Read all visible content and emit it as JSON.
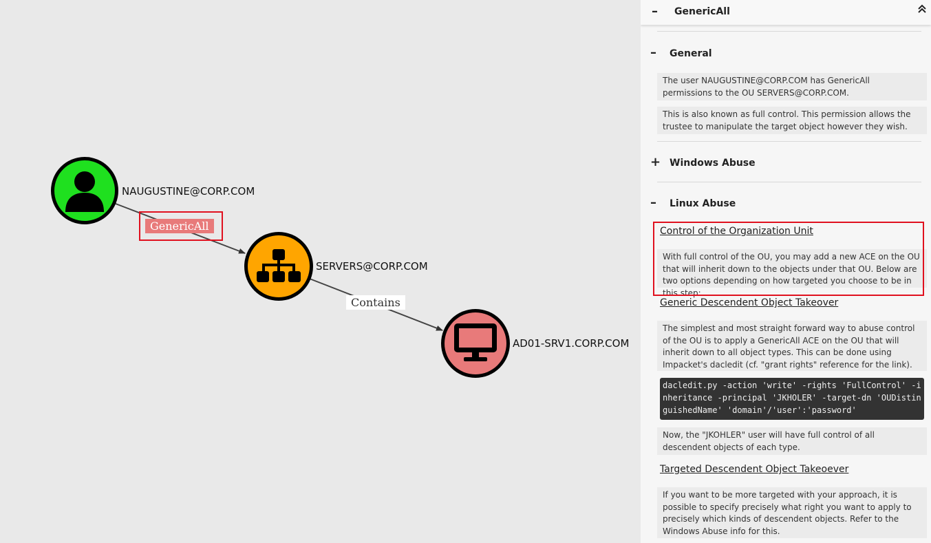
{
  "graph": {
    "nodes": {
      "user": {
        "label": "NAUGUSTINE@CORP.COM",
        "icon": "user-icon",
        "color": "#1fe01f"
      },
      "ou": {
        "label": "SERVERS@CORP.COM",
        "icon": "org-unit-icon",
        "color": "#ffa500"
      },
      "computer": {
        "label": "AD01-SRV1.CORP.COM",
        "icon": "computer-icon",
        "color": "#e87a7a"
      }
    },
    "edges": {
      "genericall": "GenericAll",
      "contains": "Contains"
    }
  },
  "panel": {
    "header": {
      "sign": "–",
      "title": "GenericAll"
    },
    "general": {
      "sign": "–",
      "title": "General",
      "p1": "The user NAUGUSTINE@CORP.COM has GenericAll permissions to the OU SERVERS@CORP.COM.",
      "p2": "This is also known as full control. This permission allows the trustee to manipulate the target object however they wish."
    },
    "windows_abuse": {
      "sign": "+",
      "title": "Windows Abuse"
    },
    "linux_abuse": {
      "sign": "–",
      "title": "Linux Abuse",
      "control_title": "Control of the Organization Unit",
      "control_text": "With full control of the OU, you may add a new ACE on the OU that will inherit down to the objects under that OU. Below are two options depending on how targeted you choose to be in this step:",
      "generic_title": "Generic Descendent Object Takeover",
      "generic_text": "The simplest and most straight forward way to abuse control of the OU is to apply a GenericAll ACE on the OU that will inherit down to all object types. This can be done using Impacket's dacledit (cf. \"grant rights\" reference for the link).",
      "generic_code": "dacledit.py -action 'write' -rights 'FullControl' -inheritance -principal 'JKHOLER' -target-dn 'OUDistinguishedName' 'domain'/'user':'password'",
      "generic_after": "Now, the \"JKOHLER\" user will have full control of all descendent objects of each type.",
      "targeted_title": "Targeted Descendent Object Takeoever",
      "targeted_text": "If you want to be more targeted with your approach, it is possible to specify precisely what right you want to apply to precisely which kinds of descendent objects. Refer to the Windows Abuse info for this."
    }
  }
}
